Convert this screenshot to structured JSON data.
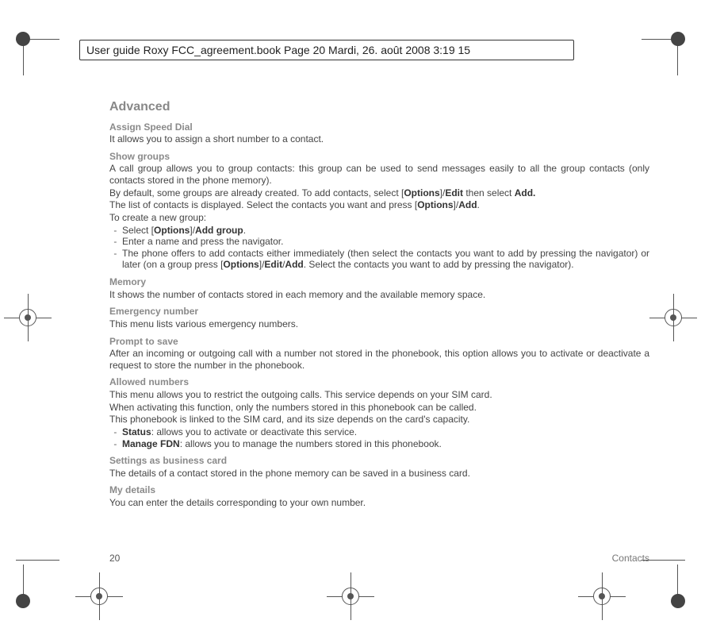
{
  "header": {
    "banner": "User guide Roxy FCC_agreement.book  Page 20  Mardi, 26. août 2008  3:19 15"
  },
  "title": "Advanced",
  "sections": {
    "assign_speed_dial": {
      "heading": "Assign Speed Dial",
      "p1": "It allows you to assign a short number to a contact."
    },
    "show_groups": {
      "heading": "Show groups",
      "p1": "A call group allows you to group contacts: this group can be used to send messages easily to all the group contacts (only contacts stored in the phone memory).",
      "p2a": "By default, some groups are already created. To add contacts, select [",
      "p2b": "Options",
      "p2c": "]/",
      "p2d": "Edit",
      "p2e": " then select ",
      "p2f": "Add.",
      "p3a": "The list of contacts is displayed. Select the contacts you want and press [",
      "p3b": "Options",
      "p3c": "]/",
      "p3d": "Add",
      "p3e": ".",
      "p4": "To create a new group:",
      "li1a": "Select [",
      "li1b": "Options",
      "li1c": "]/",
      "li1d": "Add group",
      "li1e": ".",
      "li2": "Enter a name and press the navigator.",
      "li3a": "The phone offers to add contacts either immediately (then select the contacts you want to add by pressing the navigator) or later (on a group press [",
      "li3b": "Options",
      "li3c": "]/",
      "li3d": "Edit",
      "li3e": "/",
      "li3f": "Add",
      "li3g": ". Select the contacts you want to add by pressing the navigator)."
    },
    "memory": {
      "heading": "Memory",
      "p1": "It shows the number of contacts stored in each memory and the available memory space."
    },
    "emergency": {
      "heading": "Emergency number",
      "p1": "This menu lists various emergency numbers."
    },
    "prompt": {
      "heading": "Prompt to save",
      "p1": "After an incoming or outgoing call with a number not stored in the phonebook, this option allows you to activate or deactivate a request to store the number in the phonebook."
    },
    "allowed": {
      "heading": "Allowed numbers",
      "p1": "This menu allows you to restrict the outgoing calls. This service depends on your SIM card.",
      "p2": "When activating this function, only the numbers stored in this phonebook can be called.",
      "p3": "This phonebook is linked to the SIM card, and its size depends on the card's capacity.",
      "li1a": "Status",
      "li1b": ": allows you to activate or deactivate this service.",
      "li2a": "Manage FDN",
      "li2b": ": allows you to manage the numbers stored in this phonebook."
    },
    "business": {
      "heading": "Settings as business card",
      "p1": "The details of a contact stored in the phone memory can be saved in a business card."
    },
    "mydetails": {
      "heading": "My details",
      "p1": "You can enter the details corresponding to your own number."
    }
  },
  "footer": {
    "page_number": "20",
    "section_name": "Contacts"
  }
}
